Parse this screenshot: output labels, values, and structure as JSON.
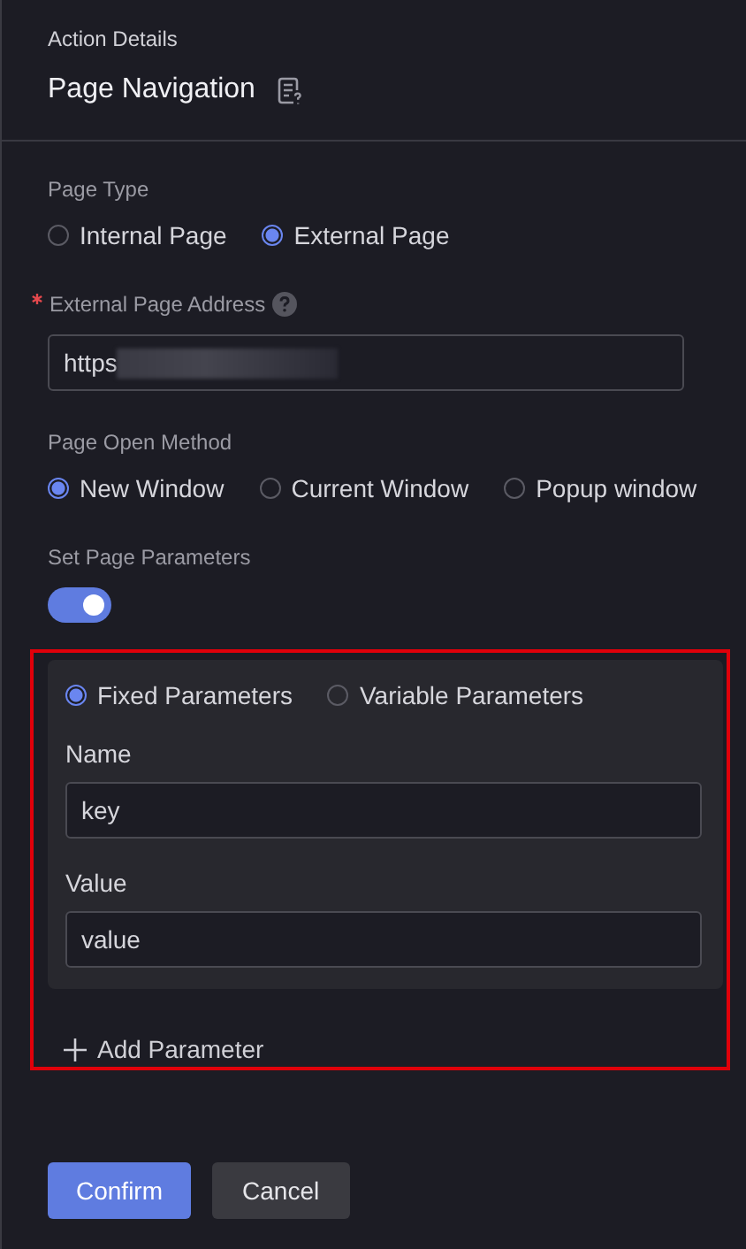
{
  "panel": {
    "caption": "Action Details",
    "title": "Page Navigation"
  },
  "page_type": {
    "label": "Page Type",
    "options": [
      {
        "label": "Internal Page",
        "selected": false
      },
      {
        "label": "External Page",
        "selected": true
      }
    ]
  },
  "address": {
    "label": "External Page Address",
    "required": true,
    "value": "https",
    "blurred": true
  },
  "open_method": {
    "label": "Page Open Method",
    "options": [
      {
        "label": "New Window",
        "selected": true
      },
      {
        "label": "Current Window",
        "selected": false
      },
      {
        "label": "Popup window",
        "selected": false
      }
    ]
  },
  "parameters": {
    "label": "Set Page Parameters",
    "on": true,
    "highlighted": true,
    "mode_options": [
      {
        "label": "Fixed Parameters",
        "selected": true
      },
      {
        "label": "Variable Parameters",
        "selected": false
      }
    ],
    "fields": [
      {
        "label": "Name",
        "value": "key"
      },
      {
        "label": "Value",
        "value": "value"
      }
    ],
    "add_label": "Add Parameter"
  },
  "buttons": [
    {
      "label": "Confirm",
      "kind": "primary"
    },
    {
      "label": "Cancel",
      "kind": "secondary"
    }
  ]
}
